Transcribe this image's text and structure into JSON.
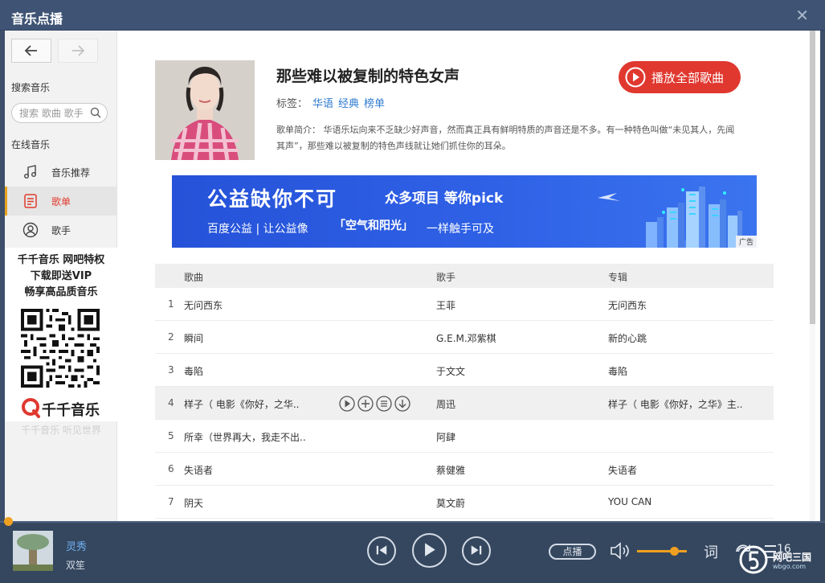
{
  "window": {
    "title": "音乐点播"
  },
  "sidebar": {
    "search_heading": "搜索音乐",
    "search_placeholder": "搜索 歌曲 歌手",
    "online_heading": "在线音乐",
    "items": [
      {
        "label": "音乐推荐",
        "icon": "music-note-icon"
      },
      {
        "label": "歌单",
        "icon": "playlist-icon",
        "active": true
      },
      {
        "label": "歌手",
        "icon": "singer-icon"
      }
    ],
    "promo": {
      "line1": "千千音乐 网吧特权",
      "line2": "下载即送VIP",
      "line3": "畅享高品质音乐",
      "brand": "千千音乐",
      "slogan": "千千音乐 听见世界"
    }
  },
  "playlist": {
    "title": "那些难以被复制的特色女声",
    "tags_label": "标签：",
    "tags": [
      "华语",
      "经典",
      "榜单"
    ],
    "description": "歌单简介： 华语乐坛向来不乏缺少好声音，然而真正具有鲜明特质的声音还是不多。有一种特色叫做“未见其人，先闻其声”，那些难以被复制的特色声线就让她们抓住你的耳朵。",
    "play_all_label": "播放全部歌曲"
  },
  "banner": {
    "line1": "公益缺你不可",
    "line2": "众多项目 等你pick",
    "line3": "百度公益 | 让公益像",
    "line3_highlight": "「空气和阳光」",
    "line3_end": "一样触手可及",
    "ad_label": "广告"
  },
  "table": {
    "headers": {
      "song": "歌曲",
      "artist": "歌手",
      "album": "专辑"
    },
    "rows": [
      {
        "no": "1",
        "song": "无问西东",
        "artist": "王菲",
        "album": "无问西东"
      },
      {
        "no": "2",
        "song": "瞬间",
        "artist": "G.E.M.邓紫棋",
        "album": "新的心跳"
      },
      {
        "no": "3",
        "song": "毒陷",
        "artist": "于文文",
        "album": "毒陷"
      },
      {
        "no": "4",
        "song": "样子（ 电影《你好，之华..",
        "artist": "周迅",
        "album": "样子（ 电影《你好，之华》主..",
        "hover": true
      },
      {
        "no": "5",
        "song": "所幸（世界再大，我走不出..",
        "artist": "阿肆",
        "album": ""
      },
      {
        "no": "6",
        "song": "失语者",
        "artist": "蔡健雅",
        "album": "失语者"
      },
      {
        "no": "7",
        "song": "阴天",
        "artist": "莫文蔚",
        "album": "YOU CAN"
      }
    ]
  },
  "player": {
    "song": "灵秀",
    "artist": "双笙",
    "dianbo_label": "点播",
    "lyric_label": "词",
    "queue_count": "16",
    "volume_level": 0.7,
    "progress": 0.0
  },
  "watermark": {
    "text": "网吧三国",
    "sub": "wbgo.com"
  },
  "colors": {
    "accent_red": "#e0382f",
    "accent_orange": "#f0a020",
    "link_blue": "#2e7bcf",
    "player_bg": "#35475f"
  }
}
